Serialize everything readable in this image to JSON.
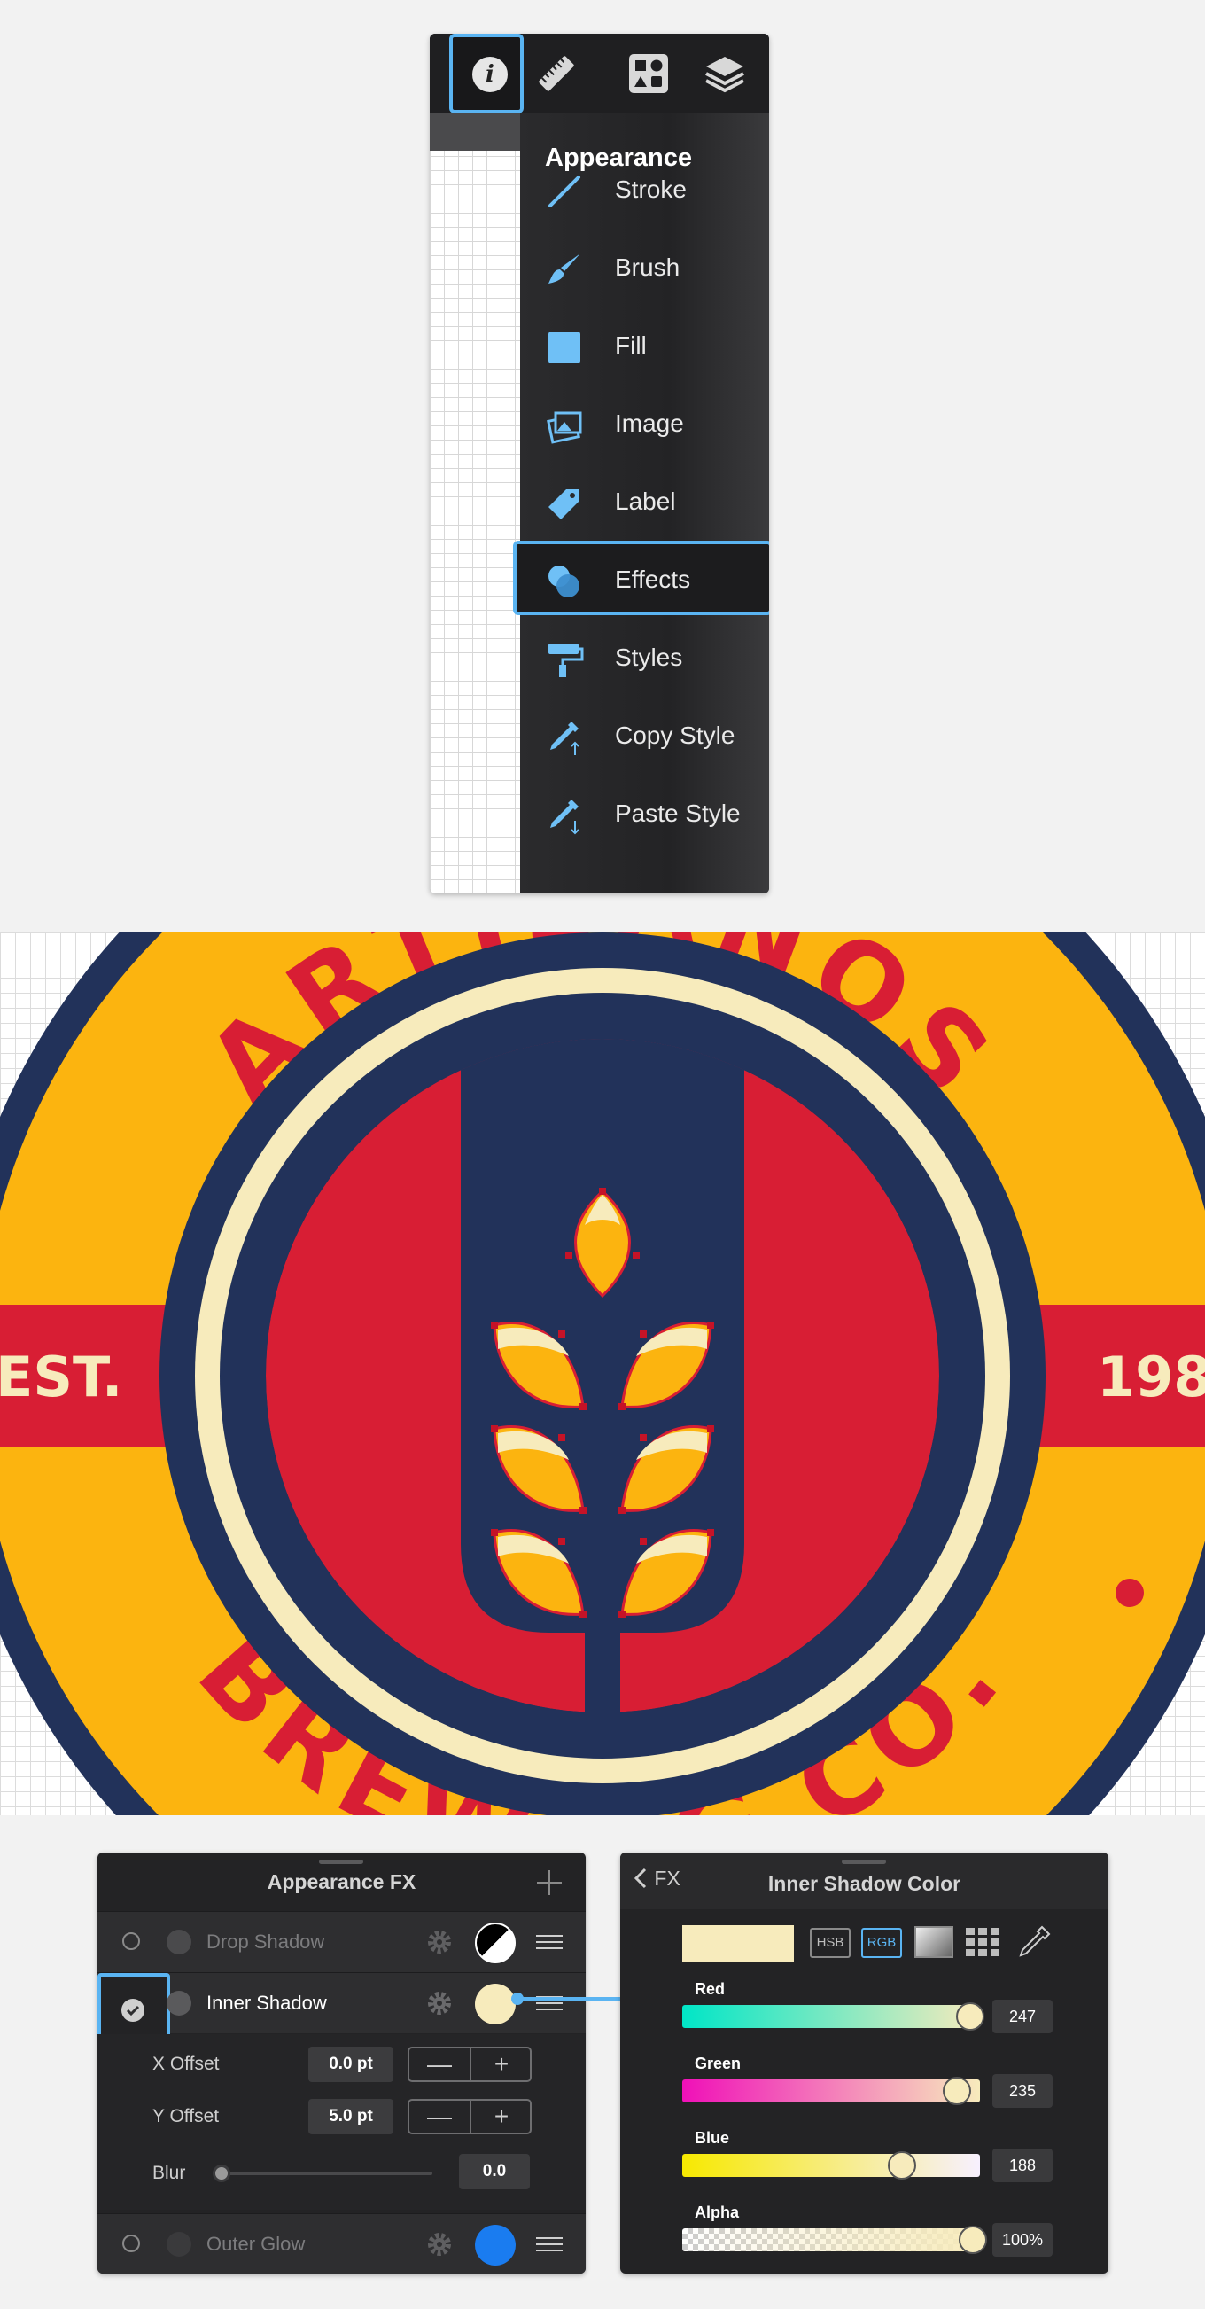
{
  "toolbar": {
    "info_icon_glyph": "i",
    "tools": [
      "info-icon",
      "ruler-icon",
      "shapes-icon",
      "layers-icon"
    ]
  },
  "appearance_menu": {
    "title": "Appearance",
    "items": [
      {
        "label": "Stroke",
        "icon": "stroke-icon"
      },
      {
        "label": "Brush",
        "icon": "brush-icon"
      },
      {
        "label": "Fill",
        "icon": "fill-icon"
      },
      {
        "label": "Image",
        "icon": "image-icon"
      },
      {
        "label": "Label",
        "icon": "label-icon"
      },
      {
        "label": "Effects",
        "icon": "effects-icon",
        "selected": true
      },
      {
        "label": "Styles",
        "icon": "styles-icon"
      },
      {
        "label": "Copy Style",
        "icon": "copy-style-icon"
      },
      {
        "label": "Paste Style",
        "icon": "paste-style-icon"
      }
    ]
  },
  "logo": {
    "text_top": "ARTISANOS",
    "text_bottom": "BREWING CO.",
    "est_label": "EST.",
    "year_label": "198",
    "colors": {
      "yellow": "#fcb40f",
      "navy": "#22325a",
      "red": "#d81e34",
      "cream": "#f7ebbc"
    }
  },
  "fx_panel": {
    "title": "Appearance FX",
    "effects": [
      {
        "name": "Drop Shadow",
        "enabled": false,
        "swatch": "#000000"
      },
      {
        "name": "Inner Shadow",
        "enabled": true,
        "swatch": "#f7ebbc"
      },
      {
        "name": "Outer Glow",
        "enabled": false,
        "swatch": "#1a7cf0"
      }
    ],
    "params": {
      "x_offset_label": "X Offset",
      "x_offset_value": "0.0 pt",
      "y_offset_label": "Y Offset",
      "y_offset_value": "5.0 pt",
      "blur_label": "Blur",
      "blur_value": "0.0",
      "minus_glyph": "—",
      "plus_glyph": "+"
    }
  },
  "color_panel": {
    "back_label": "FX",
    "title": "Inner Shadow Color",
    "swatch_color": "#f7ebbc",
    "modes": [
      "HSB",
      "RGB"
    ],
    "active_mode": "RGB",
    "sliders": [
      {
        "label": "Red",
        "value": "247",
        "fraction": 0.9686
      },
      {
        "label": "Green",
        "value": "235",
        "fraction": 0.9216
      },
      {
        "label": "Blue",
        "value": "188",
        "fraction": 0.7373
      },
      {
        "label": "Alpha",
        "value": "100%",
        "fraction": 1.0
      }
    ]
  }
}
